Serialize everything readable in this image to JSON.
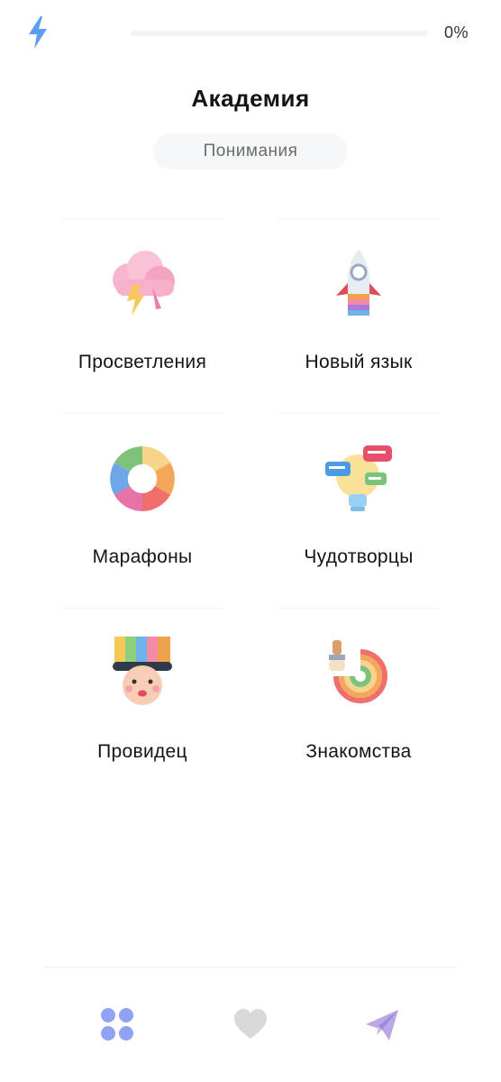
{
  "header": {
    "progress_text": "0%",
    "progress_value": 0,
    "accent_color": "#6c86f0"
  },
  "page": {
    "title": "Академия",
    "subtitle": "Понимания"
  },
  "categories": [
    {
      "label": "Просветления",
      "icon": "thundercloud-icon"
    },
    {
      "label": "Новый язык",
      "icon": "rocket-icon"
    },
    {
      "label": "Марафоны",
      "icon": "color-wheel-icon"
    },
    {
      "label": "Чудотворцы",
      "icon": "lightbulb-chat-icon"
    },
    {
      "label": "Провидец",
      "icon": "rainbow-hat-face-icon"
    },
    {
      "label": "Знакомства",
      "icon": "rainbow-brush-icon"
    }
  ],
  "nav": {
    "items": [
      {
        "icon": "apps-grid-icon",
        "active": true
      },
      {
        "icon": "heart-icon",
        "active": false
      },
      {
        "icon": "paper-plane-icon",
        "active": false
      }
    ]
  }
}
